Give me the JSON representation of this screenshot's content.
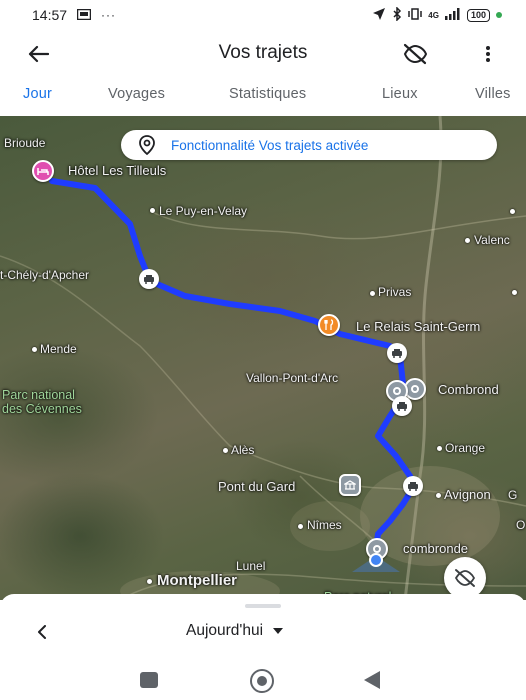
{
  "status_bar": {
    "time": "14:57",
    "network": "4G",
    "battery": "100"
  },
  "app_bar": {
    "title": "Vos trajets",
    "back_icon": "arrow-back-icon",
    "location_off_icon": "location-off-icon",
    "more_icon": "more-vert-icon"
  },
  "tabs": [
    {
      "label": "Jour",
      "active": true
    },
    {
      "label": "Voyages",
      "active": false
    },
    {
      "label": "Statistiques",
      "active": false
    },
    {
      "label": "Lieux",
      "active": false
    },
    {
      "label": "Villes",
      "active": false
    }
  ],
  "map": {
    "banner": "Fonctionnalité Vos trajets activée",
    "places": {
      "brioude": "Brioude",
      "hotel": "Hôtel Les Tilleuls",
      "le_puy": "Le Puy-en-Velay",
      "st_chely": "t-Chély-d'Apcher",
      "valence": "Valenc",
      "privas": "Privas",
      "relais": "Le Relais Saint-Germ",
      "mende": "Mende",
      "vallon": "Vallon-Pont-d'Arc",
      "combrond_top": "Combrond",
      "park": "Parc national\ndes Cévennes",
      "ales": "Alès",
      "orange": "Orange",
      "pont_du_gard": "Pont du Gard",
      "avignon": "Avignon",
      "nimes": "Nîmes",
      "combronde": "combronde",
      "lunel": "Lunel",
      "montpellier": "Montpellier",
      "edge_g": "G",
      "edge_o": "O",
      "parc_naturel": "Parc naturel"
    },
    "colors": {
      "route": "#1f3cff",
      "hotel_marker": "#e04fb0",
      "restaurant_marker": "#f28b27",
      "accent": "#1a73e8"
    }
  },
  "bottom_sheet": {
    "date_label": "Aujourd'hui"
  }
}
